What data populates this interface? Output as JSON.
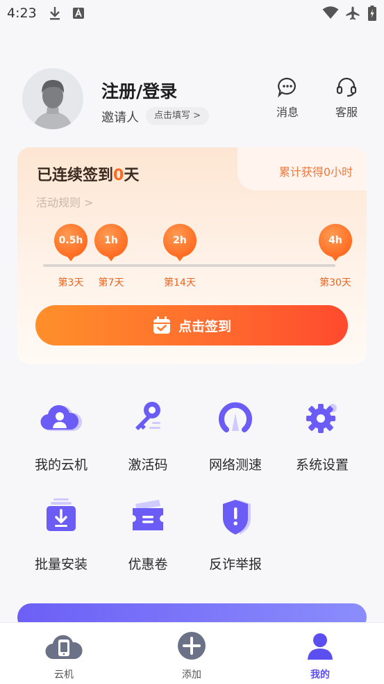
{
  "status_bar": {
    "time": "4:23",
    "left_icons": [
      "download-icon",
      "text-a-icon"
    ],
    "right_icons": [
      "wifi-icon",
      "airplane-icon",
      "battery-icon"
    ]
  },
  "profile": {
    "login_title": "注册/登录",
    "inviter_label": "邀请人",
    "inviter_chip": "点击填写 >",
    "messages_label": "消息",
    "service_label": "客服"
  },
  "sign_card": {
    "streak_prefix": "已连续签到",
    "streak_days": "0",
    "streak_suffix": "天",
    "total_earned": "累计获得0小时",
    "rules_link": "活动规则 >",
    "milestones": [
      {
        "reward": "0.5h",
        "day": "第3天"
      },
      {
        "reward": "1h",
        "day": "第7天"
      },
      {
        "reward": "2h",
        "day": "第14天"
      },
      {
        "reward": "4h",
        "day": "第30天"
      }
    ],
    "sign_button": "点击签到"
  },
  "menu": [
    {
      "label": "我的云机",
      "icon": "cloud-user-icon"
    },
    {
      "label": "激活码",
      "icon": "key-icon"
    },
    {
      "label": "网络测速",
      "icon": "speedometer-icon"
    },
    {
      "label": "系统设置",
      "icon": "gear-icon"
    },
    {
      "label": "批量安装",
      "icon": "batch-install-icon"
    },
    {
      "label": "优惠卷",
      "icon": "coupon-icon"
    },
    {
      "label": "反诈举报",
      "icon": "shield-alert-icon"
    }
  ],
  "colors": {
    "accent": "#5b4ff0",
    "orange": "#ff6a1f",
    "icon_purple": "#6b5cf6"
  },
  "bottom_nav": [
    {
      "label": "云机",
      "icon": "cloud-phone-icon",
      "active": false
    },
    {
      "label": "添加",
      "icon": "add-circle-icon",
      "active": false
    },
    {
      "label": "我的",
      "icon": "user-icon",
      "active": true
    }
  ]
}
